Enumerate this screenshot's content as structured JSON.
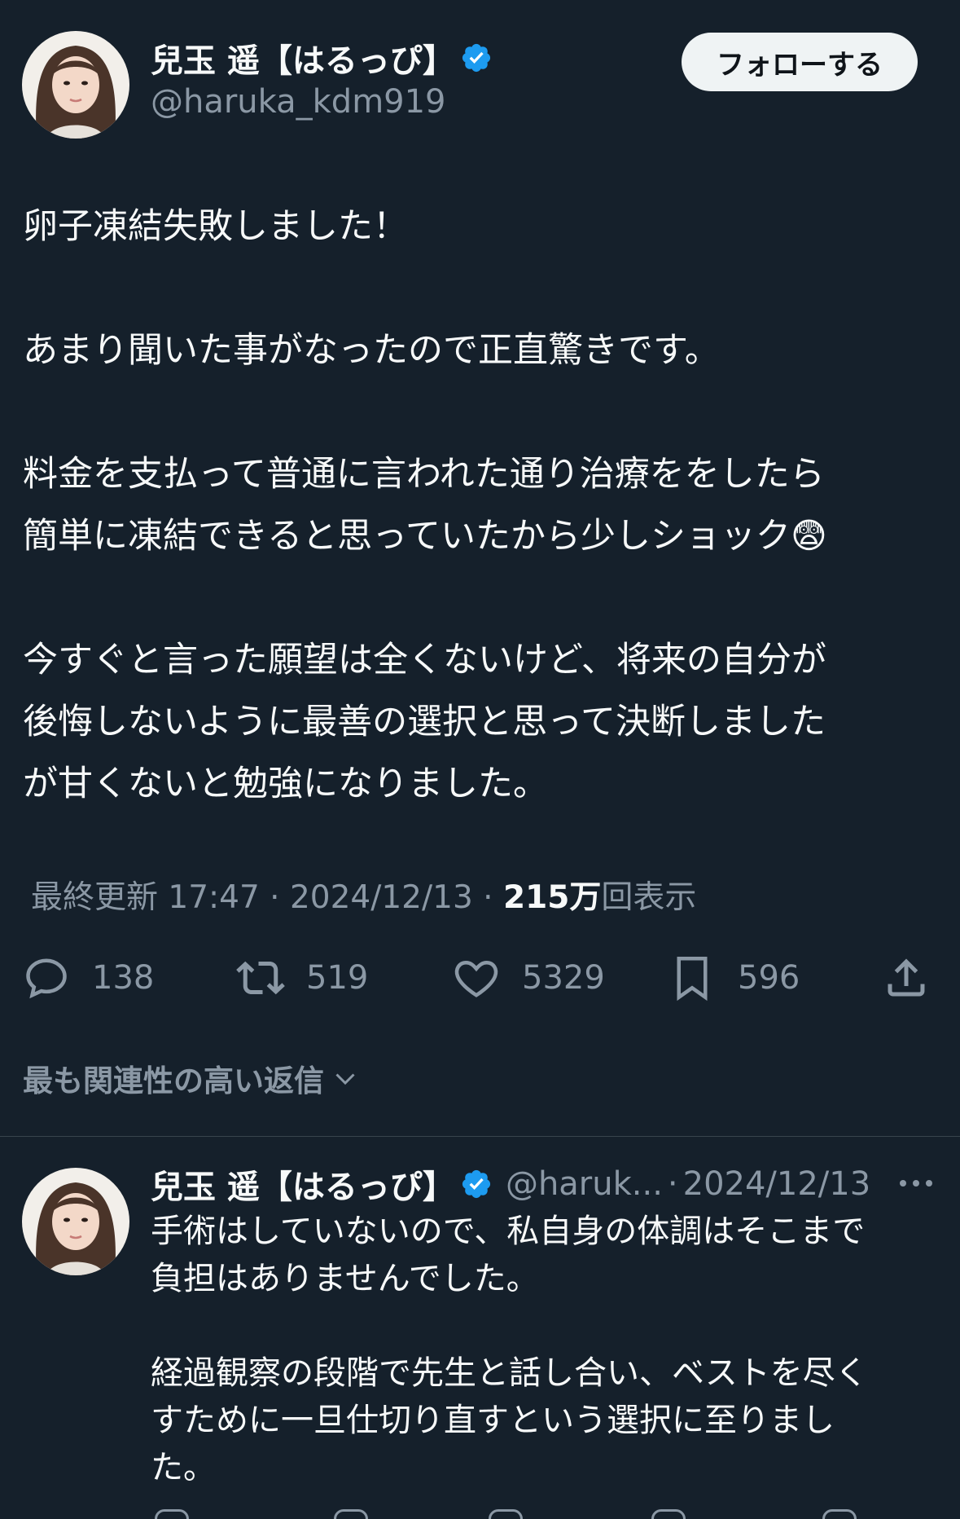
{
  "post": {
    "author": {
      "display_name": "兒玉 遥【はるっぴ】",
      "handle": "@haruka_kdm919",
      "verified": true
    },
    "follow_button_label": "フォローする",
    "body": {
      "line_1": "卵子凍結失敗しました！",
      "line_2": "あまり聞いた事がなったので正直驚きです。",
      "line_3": "料金を支払って普通に言われた通り治療ををしたら",
      "line_4": "簡単に凍結できると思っていたから少しショック😨",
      "line_5": "今すぐと言った願望は全くないけど、将来の自分が",
      "line_6": "後悔しないように最善の選択と思って決断しました",
      "line_7": "が甘くないと勉強になりました。"
    },
    "meta": {
      "updated_label": "最終更新 17:47 · 2024/12/13",
      "separator": " · ",
      "views_number": "215万",
      "views_label": "回表示"
    },
    "actions": {
      "replies": "138",
      "reposts": "519",
      "likes": "5329",
      "bookmarks": "596"
    }
  },
  "replies_sort": {
    "label": "最も関連性の高い返信"
  },
  "reply": {
    "author": {
      "display_name": "兒玉 遥【はるっぴ】",
      "handle_short": "@haruk...",
      "verified": true
    },
    "separator": "·",
    "date": "2024/12/13",
    "body": {
      "line_1": "手術はしていないので、私自身の体調はそこまで",
      "line_2": "負担はありませんでした。",
      "line_3": "経過観察の段階で先生と話し合い、ベストを尽く",
      "line_4": "すために一旦仕切り直すという選択に至りまし",
      "line_5": "た。"
    }
  },
  "colors": {
    "background": "#15202b",
    "primary_text": "#f7f9f9",
    "secondary_text": "#8b98a5",
    "verified_badge": "#1d9bf0",
    "follow_button_bg": "#eff3f4",
    "divider": "#38444d"
  },
  "icons": {
    "reply": "reply-icon",
    "repost": "repost-icon",
    "like": "heart-icon",
    "bookmark": "bookmark-icon",
    "share": "share-icon",
    "verified": "verified-badge-icon",
    "more": "more-icon",
    "sort": "chevron-down-icon"
  }
}
